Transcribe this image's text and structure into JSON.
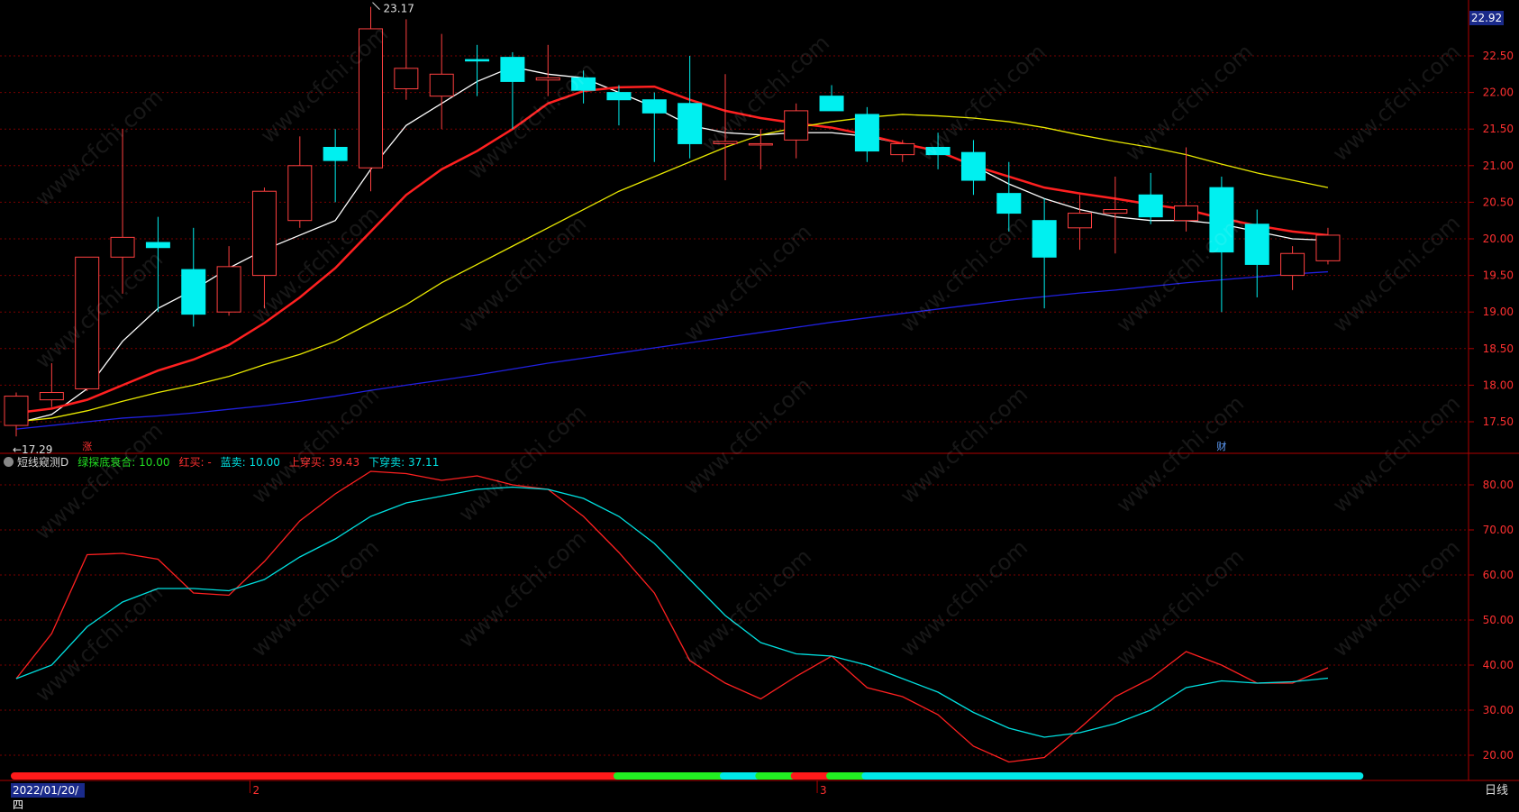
{
  "chart_data": [
    {
      "type": "candlestick",
      "period": "日线",
      "price_axis": {
        "ticks": [
          "22.50",
          "22.00",
          "21.50",
          "21.00",
          "20.50",
          "20.00",
          "19.50",
          "19.00",
          "18.50",
          "18.00",
          "17.50"
        ],
        "ylim": [
          17.15,
          23.25
        ]
      },
      "current_price_tag": "22.92",
      "high_annotation": "23.17",
      "low_annotation": "17.29",
      "markers": [
        {
          "text": "涨",
          "index": 2,
          "color": "#ff3030"
        },
        {
          "text": "财",
          "index": 34,
          "color": "#60a0ff"
        }
      ],
      "candles": [
        {
          "o": 17.45,
          "h": 17.9,
          "l": 17.3,
          "c": 17.85
        },
        {
          "o": 17.8,
          "h": 18.3,
          "l": 17.7,
          "c": 17.9
        },
        {
          "o": 17.95,
          "h": 19.75,
          "l": 17.92,
          "c": 19.75
        },
        {
          "o": 19.75,
          "h": 21.5,
          "l": 19.25,
          "c": 20.02
        },
        {
          "o": 19.95,
          "h": 20.3,
          "l": 19.0,
          "c": 19.88
        },
        {
          "o": 19.58,
          "h": 20.15,
          "l": 18.8,
          "c": 18.97
        },
        {
          "o": 19.0,
          "h": 19.9,
          "l": 18.95,
          "c": 19.62
        },
        {
          "o": 19.5,
          "h": 20.7,
          "l": 19.05,
          "c": 20.65
        },
        {
          "o": 20.25,
          "h": 21.4,
          "l": 20.15,
          "c": 21.0
        },
        {
          "o": 21.25,
          "h": 21.5,
          "l": 20.5,
          "c": 21.07
        },
        {
          "o": 20.97,
          "h": 23.17,
          "l": 20.65,
          "c": 22.87
        },
        {
          "o": 22.05,
          "h": 23.0,
          "l": 21.9,
          "c": 22.33
        },
        {
          "o": 21.95,
          "h": 22.8,
          "l": 21.5,
          "c": 22.25
        },
        {
          "o": 22.45,
          "h": 22.65,
          "l": 21.95,
          "c": 22.43
        },
        {
          "o": 22.48,
          "h": 22.55,
          "l": 21.5,
          "c": 22.15
        },
        {
          "o": 22.17,
          "h": 22.65,
          "l": 21.95,
          "c": 22.2
        },
        {
          "o": 22.2,
          "h": 22.3,
          "l": 21.85,
          "c": 22.03
        },
        {
          "o": 22.0,
          "h": 22.1,
          "l": 21.55,
          "c": 21.9
        },
        {
          "o": 21.9,
          "h": 22.0,
          "l": 21.05,
          "c": 21.72
        },
        {
          "o": 21.85,
          "h": 22.5,
          "l": 21.1,
          "c": 21.3
        },
        {
          "o": 21.3,
          "h": 22.25,
          "l": 20.8,
          "c": 21.33
        },
        {
          "o": 21.3,
          "h": 21.5,
          "l": 20.95,
          "c": 21.3
        },
        {
          "o": 21.35,
          "h": 21.85,
          "l": 21.1,
          "c": 21.75
        },
        {
          "o": 21.95,
          "h": 22.1,
          "l": 21.8,
          "c": 21.75
        },
        {
          "o": 21.7,
          "h": 21.8,
          "l": 21.05,
          "c": 21.2
        },
        {
          "o": 21.15,
          "h": 21.35,
          "l": 21.05,
          "c": 21.3
        },
        {
          "o": 21.25,
          "h": 21.45,
          "l": 20.95,
          "c": 21.15
        },
        {
          "o": 21.18,
          "h": 21.35,
          "l": 20.6,
          "c": 20.8
        },
        {
          "o": 20.62,
          "h": 21.05,
          "l": 20.1,
          "c": 20.35
        },
        {
          "o": 20.25,
          "h": 20.55,
          "l": 19.05,
          "c": 19.75
        },
        {
          "o": 20.15,
          "h": 20.6,
          "l": 19.85,
          "c": 20.35
        },
        {
          "o": 20.35,
          "h": 20.85,
          "l": 19.8,
          "c": 20.4
        },
        {
          "o": 20.6,
          "h": 20.9,
          "l": 20.2,
          "c": 20.3
        },
        {
          "o": 20.25,
          "h": 21.25,
          "l": 20.1,
          "c": 20.45
        },
        {
          "o": 20.7,
          "h": 20.85,
          "l": 19.0,
          "c": 19.82
        },
        {
          "o": 20.2,
          "h": 20.4,
          "l": 19.2,
          "c": 19.65
        },
        {
          "o": 19.5,
          "h": 19.9,
          "l": 19.3,
          "c": 19.8
        },
        {
          "o": 19.7,
          "h": 20.15,
          "l": 19.65,
          "c": 20.05
        }
      ],
      "series": [
        {
          "color": "#ffffff",
          "values": [
            17.48,
            17.6,
            17.95,
            18.6,
            19.05,
            19.3,
            19.6,
            19.85,
            20.05,
            20.25,
            20.95,
            21.55,
            21.85,
            22.15,
            22.35,
            22.25,
            22.2,
            22.0,
            21.8,
            21.55,
            21.45,
            21.42,
            21.45,
            21.45,
            21.4,
            21.3,
            21.2,
            21.0,
            20.75,
            20.55,
            20.4,
            20.3,
            20.25,
            20.25,
            20.2,
            20.1,
            20.0,
            19.98
          ]
        },
        {
          "color": "#ff2020",
          "values": [
            17.62,
            17.68,
            17.8,
            18.0,
            18.2,
            18.35,
            18.55,
            18.85,
            19.2,
            19.6,
            20.1,
            20.6,
            20.95,
            21.2,
            21.5,
            21.85,
            22.02,
            22.07,
            22.08,
            21.9,
            21.75,
            21.65,
            21.58,
            21.52,
            21.42,
            21.3,
            21.2,
            21.0,
            20.85,
            20.7,
            20.62,
            20.55,
            20.47,
            20.4,
            20.28,
            20.18,
            20.1,
            20.05
          ]
        },
        {
          "color": "#e8e800",
          "values": [
            17.5,
            17.55,
            17.65,
            17.78,
            17.9,
            18.0,
            18.12,
            18.28,
            18.42,
            18.6,
            18.85,
            19.1,
            19.4,
            19.65,
            19.9,
            20.15,
            20.4,
            20.65,
            20.85,
            21.05,
            21.25,
            21.42,
            21.52,
            21.6,
            21.66,
            21.7,
            21.68,
            21.65,
            21.6,
            21.52,
            21.42,
            21.33,
            21.25,
            21.15,
            21.02,
            20.9,
            20.8,
            20.7
          ]
        },
        {
          "color": "#2020e0",
          "values": [
            17.4,
            17.45,
            17.5,
            17.55,
            17.58,
            17.62,
            17.67,
            17.72,
            17.78,
            17.85,
            17.93,
            18.0,
            18.07,
            18.14,
            18.22,
            18.3,
            18.37,
            18.44,
            18.51,
            18.58,
            18.65,
            18.72,
            18.79,
            18.86,
            18.92,
            18.98,
            19.04,
            19.1,
            19.16,
            19.21,
            19.26,
            19.3,
            19.35,
            19.4,
            19.44,
            19.48,
            19.52,
            19.55
          ]
        }
      ]
    },
    {
      "type": "line",
      "indicator_name": "短线窥测D",
      "legend": [
        {
          "label": "绿探底衰合: ",
          "value": "10.00",
          "color": "#22dd22"
        },
        {
          "label": "红买: ",
          "value": "-",
          "color": "#ff3030"
        },
        {
          "label": "蓝卖: ",
          "value": "10.00",
          "color": "#00e0e0"
        },
        {
          "label": "上穿买: ",
          "value": "39.43",
          "color": "#ff3030"
        },
        {
          "label": "下穿卖: ",
          "value": "37.11",
          "color": "#00e0e0"
        }
      ],
      "y_axis": {
        "ticks": [
          "80.00",
          "70.00",
          "60.00",
          "50.00",
          "40.00",
          "30.00",
          "20.00"
        ],
        "ylim": [
          13.5,
          86.5
        ]
      },
      "series": [
        {
          "color": "#ff2020",
          "values": [
            37,
            47,
            64.5,
            64.8,
            63.5,
            56,
            55.5,
            63,
            72,
            78,
            83,
            82.5,
            81,
            82,
            80,
            79,
            73,
            65,
            56,
            41,
            36,
            32.5,
            37.5,
            42,
            35,
            33,
            29,
            22,
            18.5,
            19.5,
            26,
            33,
            37,
            43,
            40,
            36,
            36,
            39.4
          ]
        },
        {
          "color": "#00e0e0",
          "values": [
            37,
            40,
            48.5,
            54,
            57,
            57,
            56.5,
            59,
            64,
            68,
            73,
            76,
            77.5,
            79,
            79.5,
            79,
            77,
            73,
            67,
            59,
            51,
            45,
            42.5,
            42,
            40,
            37,
            34,
            29.5,
            26,
            24,
            25,
            27,
            30,
            35,
            36.5,
            36,
            36.3,
            37.1
          ]
        }
      ],
      "signal_bar": [
        {
          "from": 0,
          "to": 17,
          "color": "#ff1a1a"
        },
        {
          "from": 17,
          "to": 20,
          "color": "#22ee22"
        },
        {
          "from": 20,
          "to": 21,
          "color": "#00e8e8"
        },
        {
          "from": 21,
          "to": 22,
          "color": "#22ee22"
        },
        {
          "from": 22,
          "to": 23,
          "color": "#ff1a1a"
        },
        {
          "from": 23,
          "to": 24,
          "color": "#22ee22"
        },
        {
          "from": 24,
          "to": 38,
          "color": "#00e8e8"
        }
      ]
    }
  ],
  "x_axis": {
    "start_date": "2022/01/20/四",
    "month_marks": [
      {
        "text": "2",
        "index": 7
      },
      {
        "text": "3",
        "index": 23
      }
    ]
  },
  "watermark": "www.cfchi.com"
}
